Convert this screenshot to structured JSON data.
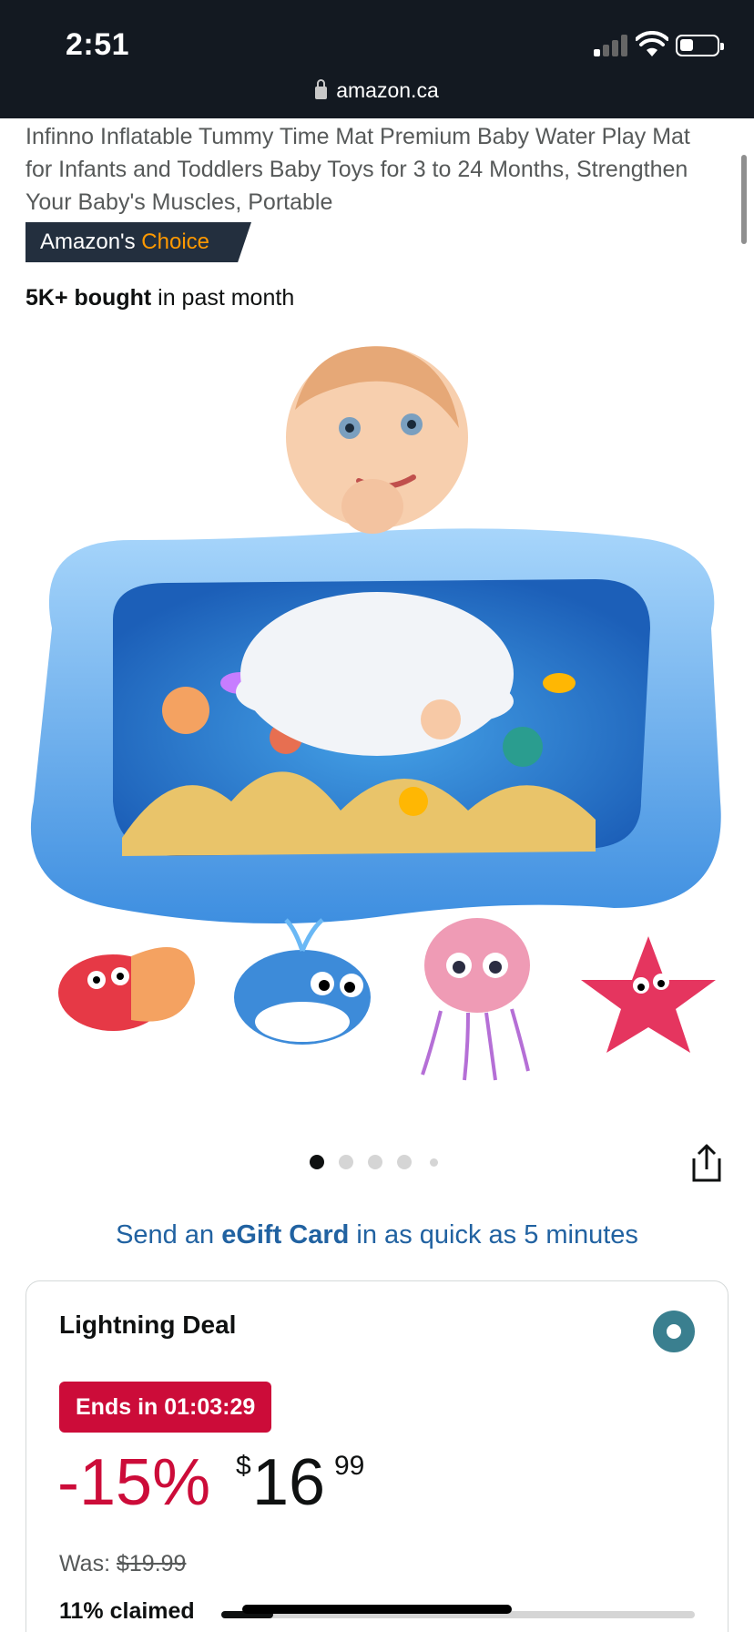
{
  "status_bar": {
    "time": "2:51",
    "url": "amazon.ca"
  },
  "product": {
    "title": "Infinno Inflatable Tummy Time Mat Premium Baby Water Play Mat for Infants and Toddlers Baby Toys for 3 to 24 Months, Strengthen Your Baby's Muscles, Portable",
    "badge_prefix": "Amazon's",
    "badge_accent": "Choice",
    "bought_strong": "5K+ bought",
    "bought_rest": " in past month"
  },
  "gallery": {
    "image_count": 5,
    "active_index": 0
  },
  "egift": {
    "pre": "Send an ",
    "strong": "eGift Card",
    "post": " in as quick as 5 minutes"
  },
  "deal": {
    "title": "Lightning Deal",
    "ends_in": "Ends in 01:03:29",
    "discount": "-15%",
    "currency": "$",
    "price_whole": "16",
    "price_fraction": "99",
    "was_label": "Was:",
    "was_price": "$19.99",
    "claimed_label": "11% claimed",
    "claimed_fraction": 0.11
  },
  "colors": {
    "header_bg": "#131921",
    "badge_bg": "#232f3e",
    "choice_accent": "#ff9900",
    "deal_red": "#cc0c39",
    "link_blue": "#2162a1",
    "radio_teal": "#3a7f8f"
  }
}
